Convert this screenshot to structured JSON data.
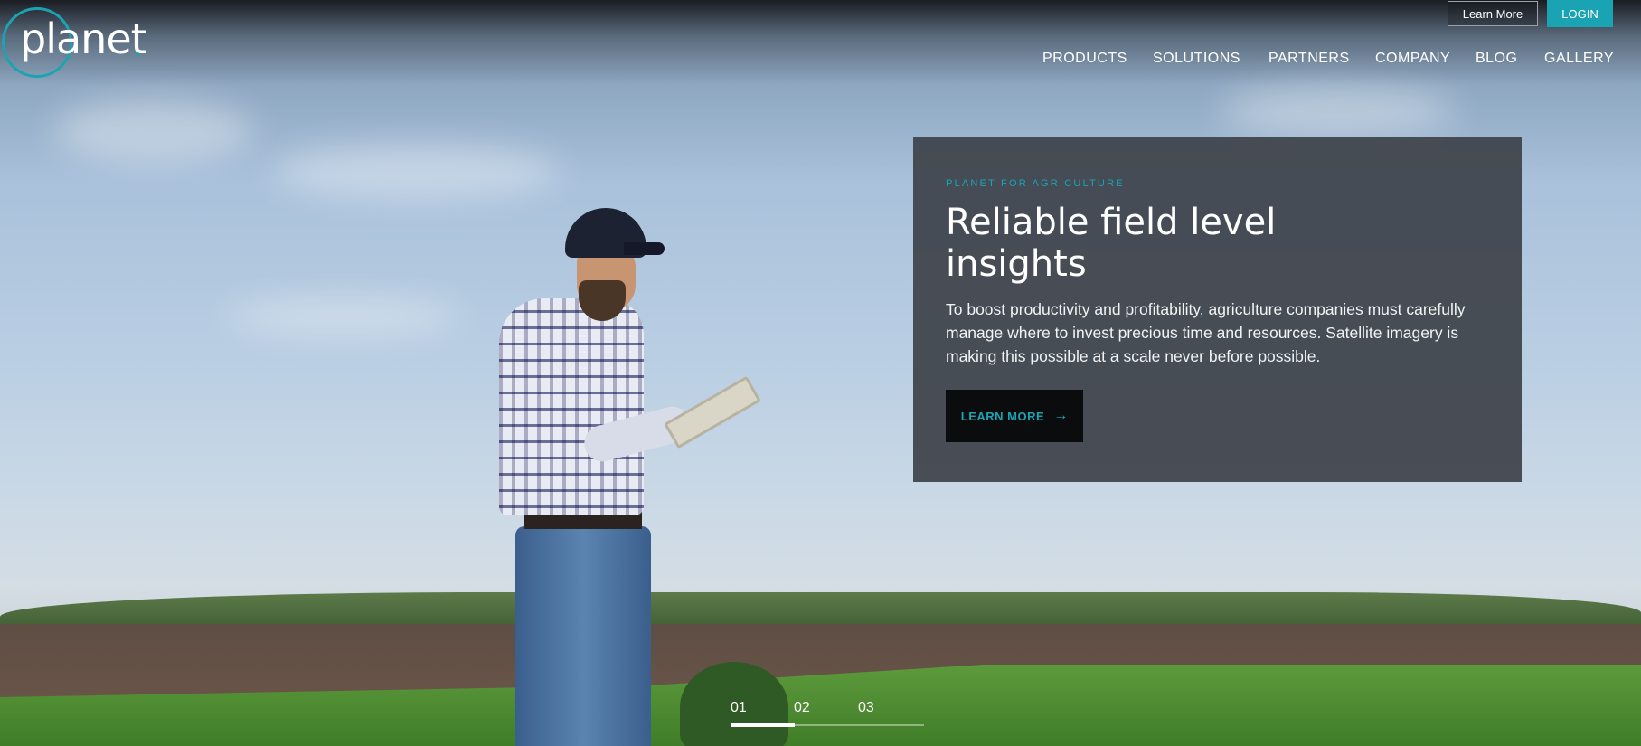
{
  "brand": {
    "logo_text": "planet",
    "accent": "#1aa4b3"
  },
  "top_buttons": {
    "learn_more": "Learn More",
    "login": "LOGIN"
  },
  "nav": {
    "items": [
      {
        "label": "PRODUCTS"
      },
      {
        "label": "SOLUTIONS"
      },
      {
        "label": "PARTNERS"
      },
      {
        "label": "COMPANY"
      },
      {
        "label": "BLOG"
      },
      {
        "label": "GALLERY"
      }
    ]
  },
  "hero_card": {
    "eyebrow": "PLANET FOR AGRICULTURE",
    "headline": "Reliable field level insights",
    "body": "To boost productivity and profitability, agriculture companies must carefully manage where to invest precious time and resources. Satellite imagery is making this possible at a scale never before possible.",
    "cta_label": "LEARN MORE",
    "cta_icon": "arrow-right-icon"
  },
  "slider": {
    "slides": [
      "01",
      "02",
      "03"
    ],
    "active_index": 0,
    "progress_fraction": 0.33
  }
}
